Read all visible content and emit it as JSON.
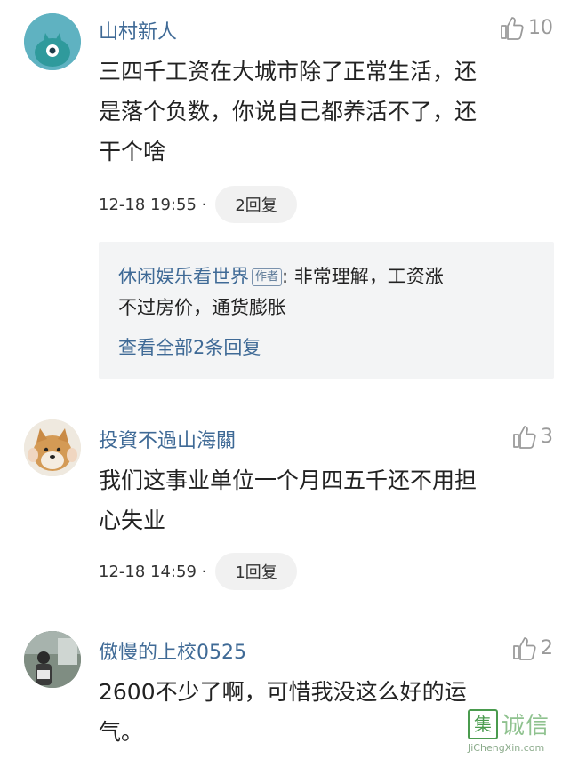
{
  "comments": [
    {
      "username": "山村新人",
      "likes": "10",
      "lines": [
        "三四千工资在大城市除了正常生活，还",
        "是落个负数，你说自己都养活不了，还",
        "干个啥"
      ],
      "time": "12-18 19:55 ·",
      "reply_label": "2回复",
      "sub_reply": {
        "username": "休闲娱乐看世界",
        "author_tag": "作者",
        "text_line1": ": 非常理解，工资涨",
        "text_line2": "不过房价，通货膨胀",
        "view_all": "查看全部2条回复"
      }
    },
    {
      "username": "投資不過山海關",
      "likes": "3",
      "lines": [
        "我们这事业单位一个月四五千还不用担",
        "心失业"
      ],
      "time": "12-18 14:59 ·",
      "reply_label": "1回复"
    },
    {
      "username": "傲慢的上校0525",
      "likes": "2",
      "lines": [
        "2600不少了啊，可惜我没这么好的运",
        "气。"
      ]
    }
  ],
  "watermark": {
    "cn": "诚信",
    "en": "JiChengXin.com",
    "logo": "集"
  },
  "colors": {
    "username": "#3f6a96",
    "like": "#9a9a9a",
    "reply_bg": "#f1f1f1",
    "subbox_bg": "#f3f4f5"
  },
  "icons": {
    "like": "thumbs-up-icon"
  }
}
